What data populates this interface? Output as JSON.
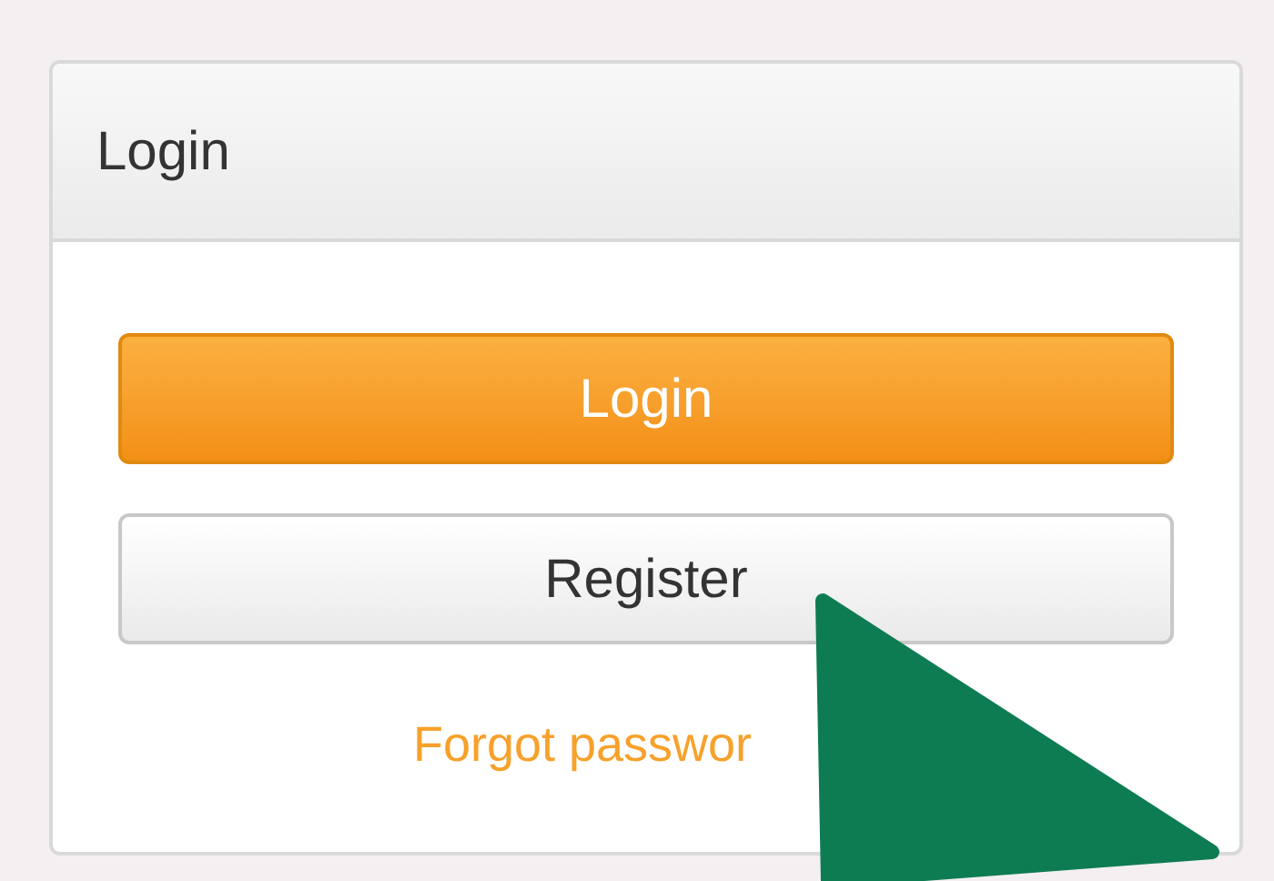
{
  "panel": {
    "title": "Login"
  },
  "buttons": [
    {
      "label": "Login",
      "kind": "primary"
    },
    {
      "label": "Register",
      "kind": "default"
    }
  ],
  "link": "Forgot passwor"
}
